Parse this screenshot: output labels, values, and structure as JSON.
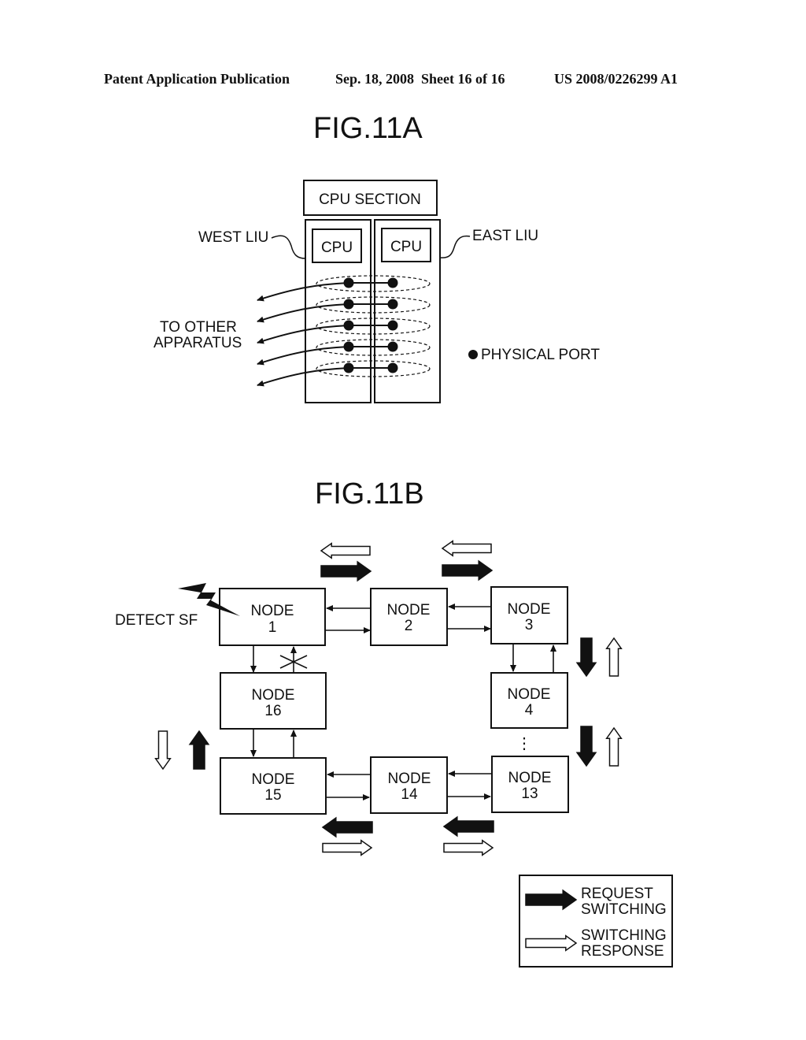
{
  "header": {
    "left": "Patent Application Publication",
    "middle": "Sep. 18, 2008  Sheet 16 of 16",
    "right": "US 2008/0226299 A1"
  },
  "fig11a": {
    "title": "FIG.11A",
    "cpu_section": "CPU SECTION",
    "cpu_left": "CPU",
    "cpu_right": "CPU",
    "west_liu": "WEST LIU",
    "east_liu": "EAST LIU",
    "to_other_line1": "TO OTHER",
    "to_other_line2": "APPARATUS",
    "legend_physical_port": "PHYSICAL PORT",
    "port_pairs": 5
  },
  "fig11b": {
    "title": "FIG.11B",
    "detect_sf": "DETECT SF",
    "node_word": "NODE",
    "nodes": [
      "1",
      "2",
      "3",
      "4",
      "13",
      "14",
      "15",
      "16"
    ],
    "ellipsis": "⋮",
    "legend": {
      "request_line1": "REQUEST",
      "request_line2": "SWITCHING",
      "response_line1": "SWITCHING",
      "response_line2": "RESPONSE"
    }
  }
}
